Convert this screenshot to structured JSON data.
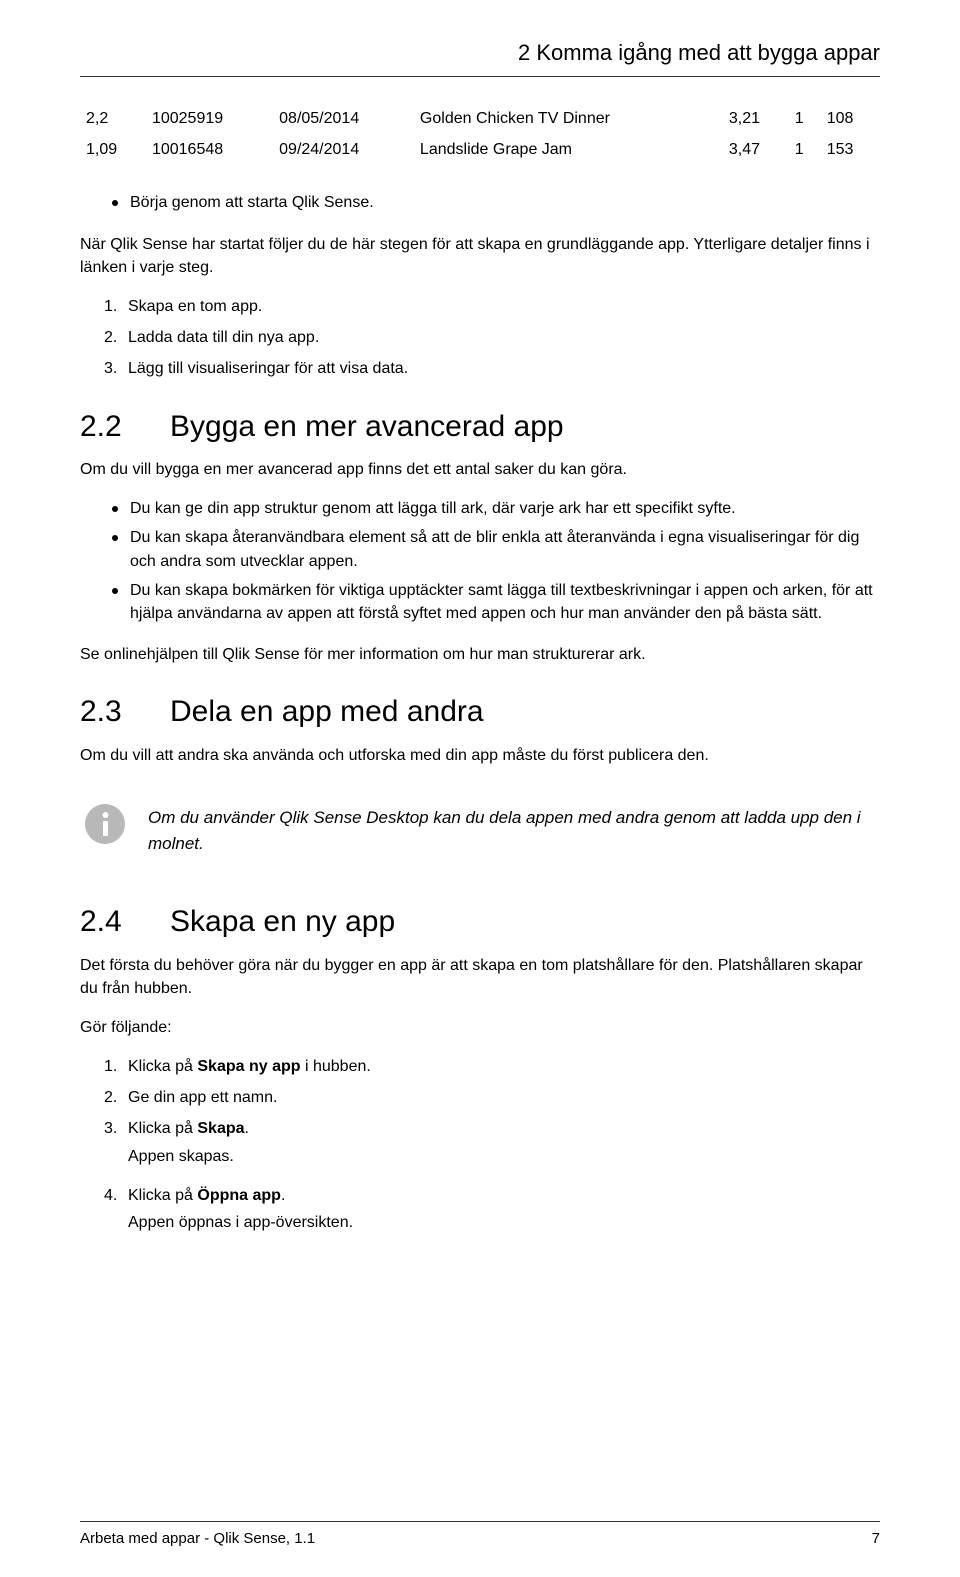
{
  "running_header": "2   Komma igång med att bygga appar",
  "table": {
    "rows": [
      {
        "c1": "2,2",
        "c2": "10025919",
        "c3": "08/05/2014",
        "c4": "Golden Chicken TV Dinner",
        "c5": "3,21",
        "c6": "1",
        "c7": "108"
      },
      {
        "c1": "1,09",
        "c2": "10016548",
        "c3": "09/24/2014",
        "c4": "Landslide Grape Jam",
        "c5": "3,47",
        "c6": "1",
        "c7": "153"
      }
    ]
  },
  "bullet_start": "Börja genom att starta Qlik Sense.",
  "intro_after_bullet": "När Qlik Sense har startat följer du de här stegen för att skapa en grundläggande app. Ytterligare detaljer finns i länken i varje steg.",
  "steps_a": [
    {
      "n": "1.",
      "t": "Skapa en tom app."
    },
    {
      "n": "2.",
      "t": "Ladda data till din nya app."
    },
    {
      "n": "3.",
      "t": "Lägg till visualiseringar för att visa data."
    }
  ],
  "sec22": {
    "num": "2.2",
    "title": "Bygga en mer avancerad app"
  },
  "sec22_intro": "Om du vill bygga en mer avancerad app finns det ett antal saker du kan göra.",
  "sec22_bullets": [
    "Du kan ge din app struktur genom att lägga till ark, där varje ark har ett specifikt syfte.",
    "Du kan skapa återanvändbara element så att de blir enkla att återanvända i egna visualiseringar för dig och andra som utvecklar appen.",
    "Du kan skapa bokmärken för viktiga upptäckter samt lägga till textbeskrivningar i appen och arken, för att hjälpa användarna av appen att förstå syftet med appen och hur man använder den på bästa sätt."
  ],
  "sec22_after": "Se onlinehjälpen till Qlik Sense för mer information om hur man strukturerar ark.",
  "sec23": {
    "num": "2.3",
    "title": "Dela en app med andra"
  },
  "sec23_intro": "Om du vill att andra ska använda och utforska med din app måste du först publicera den.",
  "note23": "Om du använder Qlik Sense Desktop kan du dela appen med andra genom att ladda upp den i molnet.",
  "sec24": {
    "num": "2.4",
    "title": "Skapa en ny app"
  },
  "sec24_intro": "Det första du behöver göra när du bygger en app är att skapa en tom platshållare för den. Platshållaren skapar du från hubben.",
  "sec24_lead": "Gör följande:",
  "steps_b": [
    {
      "n": "1.",
      "pre": "Klicka på ",
      "bold": "Skapa ny app",
      "post": " i hubben.",
      "sub": ""
    },
    {
      "n": "2.",
      "pre": "Ge din app ett namn.",
      "bold": "",
      "post": "",
      "sub": ""
    },
    {
      "n": "3.",
      "pre": "Klicka på ",
      "bold": "Skapa",
      "post": ".",
      "sub": "Appen skapas."
    },
    {
      "n": "4.",
      "pre": "Klicka på ",
      "bold": "Öppna app",
      "post": ".",
      "sub": "Appen öppnas i app-översikten."
    }
  ],
  "footer": {
    "left": "Arbeta med appar - Qlik Sense, 1.1",
    "right": "7"
  }
}
